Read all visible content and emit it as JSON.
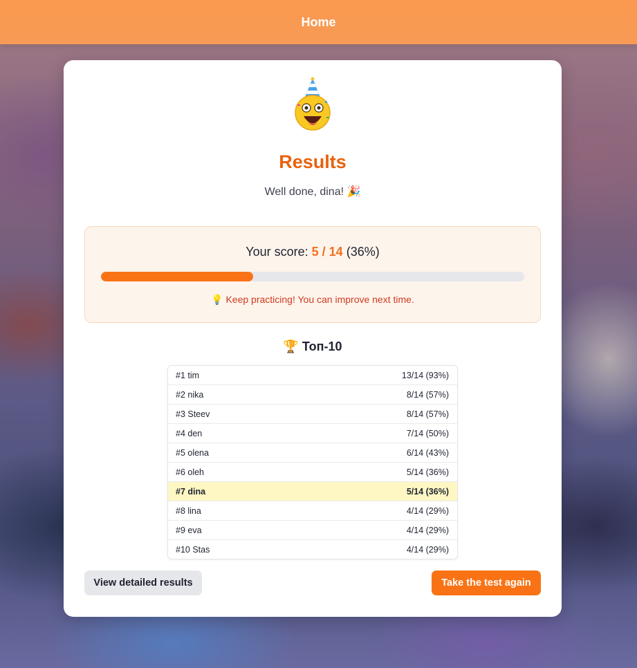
{
  "nav": {
    "home_label": "Home"
  },
  "result": {
    "emoji_icon": "party-face-icon",
    "title": "Results",
    "subtitle": "Well done, dina! 🎉",
    "score_label": "Your score:",
    "score_value": "5 / 14",
    "score_percent": "(36%)",
    "progress_fraction": 0.36,
    "hint": "💡 Keep practicing! You can improve next time."
  },
  "leaderboard": {
    "title": "🏆 Топ-10",
    "rows": [
      {
        "rank_name": "#1 tim",
        "score": "13/14 (93%)",
        "is_me": false
      },
      {
        "rank_name": "#2 nika",
        "score": "8/14 (57%)",
        "is_me": false
      },
      {
        "rank_name": "#3 Steev",
        "score": "8/14 (57%)",
        "is_me": false
      },
      {
        "rank_name": "#4 den",
        "score": "7/14 (50%)",
        "is_me": false
      },
      {
        "rank_name": "#5 olena",
        "score": "6/14 (43%)",
        "is_me": false
      },
      {
        "rank_name": "#6 oleh",
        "score": "5/14 (36%)",
        "is_me": false
      },
      {
        "rank_name": "#7 dina",
        "score": "5/14 (36%)",
        "is_me": true
      },
      {
        "rank_name": "#8 lina",
        "score": "4/14 (29%)",
        "is_me": false
      },
      {
        "rank_name": "#9 eva",
        "score": "4/14 (29%)",
        "is_me": false
      },
      {
        "rank_name": "#10 Stas",
        "score": "4/14 (29%)",
        "is_me": false
      }
    ]
  },
  "actions": {
    "details_label": "View detailed results",
    "retry_label": "Take the test again"
  },
  "colors": {
    "accent": "#f97316",
    "title": "#e8620f",
    "highlight_row": "#fef7c3"
  }
}
